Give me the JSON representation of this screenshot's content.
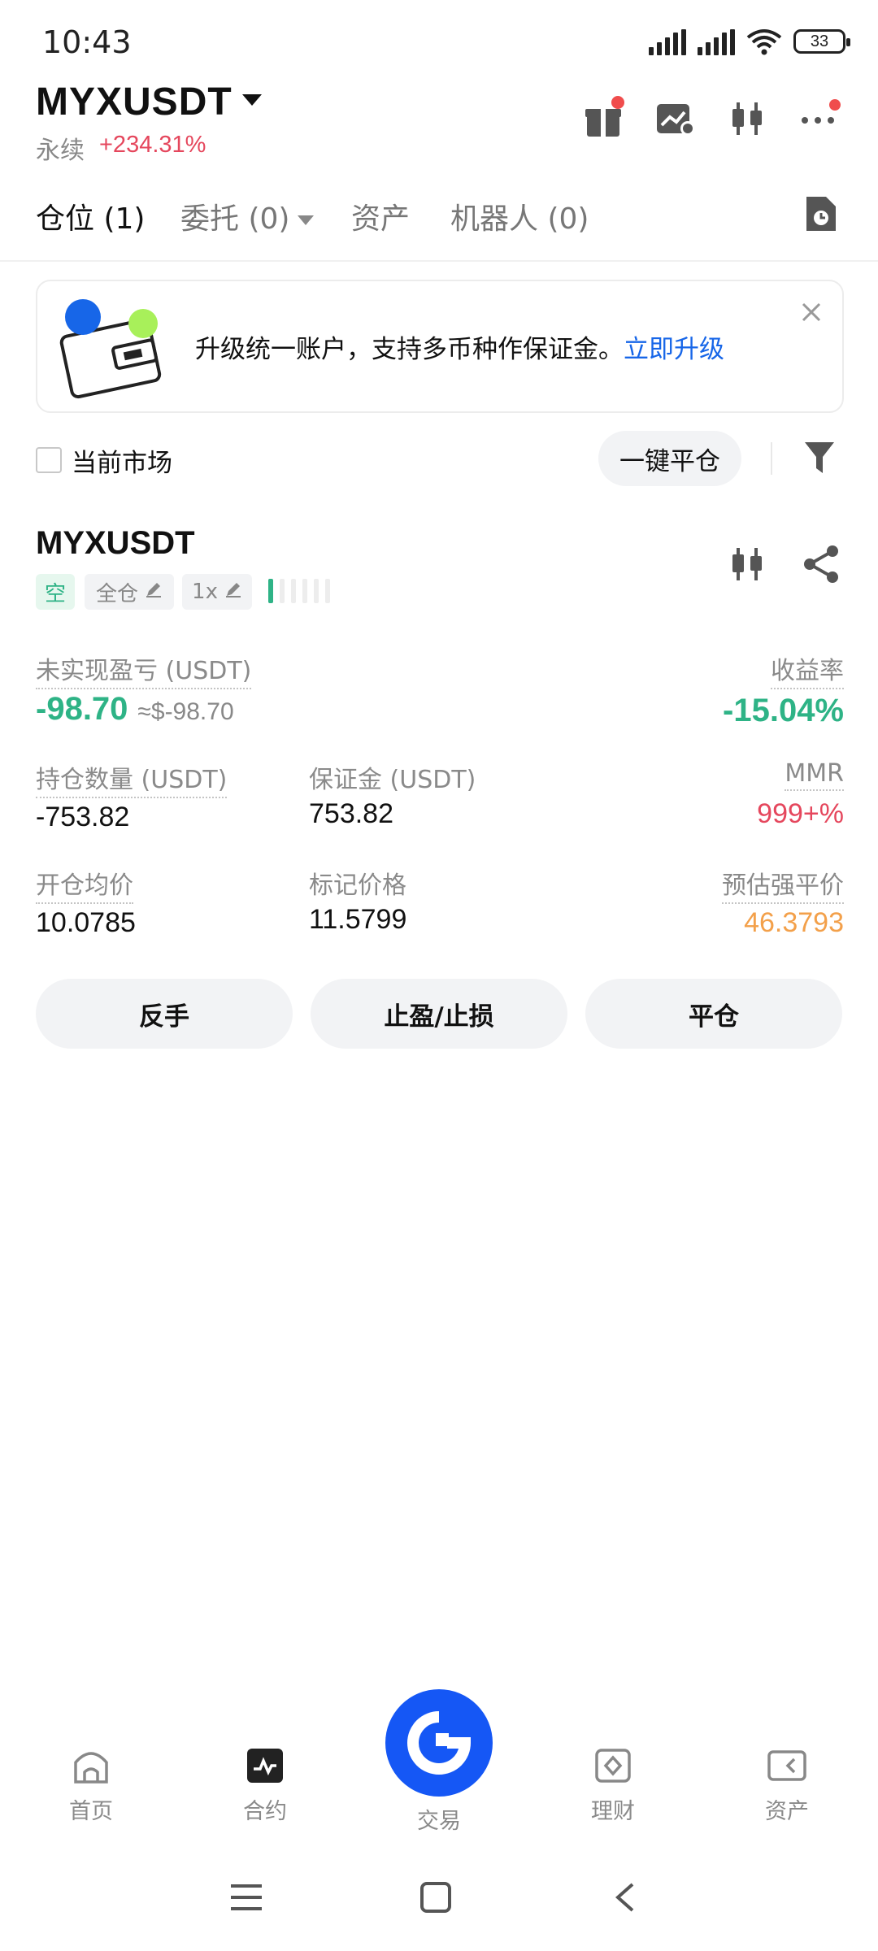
{
  "status_bar": {
    "time": "10:43",
    "battery": "33"
  },
  "header": {
    "pair": "MYXUSDT",
    "contract_type": "永续",
    "change_24h": "+234.31%"
  },
  "tabs": [
    {
      "label": "仓位 (1)"
    },
    {
      "label": "委托 (0)"
    },
    {
      "label": "资产"
    },
    {
      "label": "机器人 (0)"
    }
  ],
  "banner": {
    "text": "升级统一账户，支持多币种作保证金。",
    "link": "立即升级"
  },
  "filter": {
    "current_market_label": "当前市场",
    "close_all_label": "一键平仓"
  },
  "position": {
    "symbol": "MYXUSDT",
    "side_tag": "空",
    "margin_mode_tag": "全仓",
    "leverage_tag": "1x",
    "risk_level": 1,
    "unrealized_pnl_label": "未实现盈亏 (USDT)",
    "unrealized_pnl": "-98.70",
    "unrealized_pnl_usd": "≈$-98.70",
    "roe_label": "收益率",
    "roe": "-15.04%",
    "size_label": "持仓数量 (USDT)",
    "size": "-753.82",
    "margin_label": "保证金 (USDT)",
    "margin": "753.82",
    "mmr_label": "MMR",
    "mmr": "999+%",
    "entry_price_label": "开仓均价",
    "entry_price": "10.0785",
    "mark_price_label": "标记价格",
    "mark_price": "11.5799",
    "liq_price_label": "预估强平价",
    "liq_price": "46.3793"
  },
  "actions": {
    "reverse": "反手",
    "tp_sl": "止盈/止损",
    "close": "平仓"
  },
  "bottom_nav": [
    {
      "label": "首页",
      "icon": "home-icon"
    },
    {
      "label": "合约",
      "icon": "futures-icon"
    },
    {
      "label": "交易",
      "icon": "trade-icon"
    },
    {
      "label": "理财",
      "icon": "earn-icon"
    },
    {
      "label": "资产",
      "icon": "assets-icon"
    }
  ],
  "colors": {
    "positive": "#2eb386",
    "negative": "#e5475d",
    "warning": "#f3a04a",
    "brand": "#1557f5",
    "link": "#1766e8"
  }
}
